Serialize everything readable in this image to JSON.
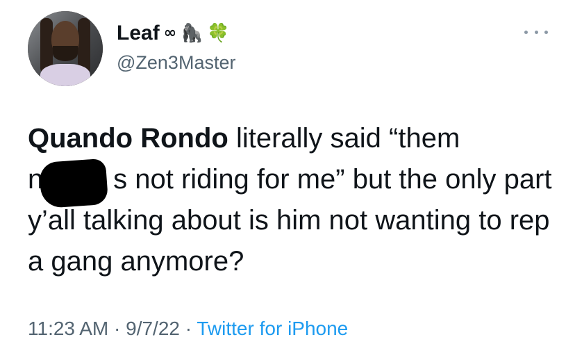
{
  "user": {
    "display_name": "Leaf",
    "name_emojis": [
      "∞",
      "🦍",
      "🍀"
    ],
    "handle": "@Zen3Master"
  },
  "tweet": {
    "mention": "Quando Rondo",
    "text_part1": " literally said “them",
    "text_redacted_prefix": "ni",
    "text_redacted_suffix": "s",
    "text_part2": " not riding for me” but the only part y’all talking about is him not wanting to rep a gang anymore?"
  },
  "meta": {
    "time": "11:23 AM",
    "separator": " · ",
    "date": "9/7/22",
    "source": "Twitter for iPhone"
  },
  "colors": {
    "text": "#0f1419",
    "secondary": "#536471",
    "link": "#1d9bf0"
  },
  "icons": {
    "more": "more-horizontal-icon"
  }
}
